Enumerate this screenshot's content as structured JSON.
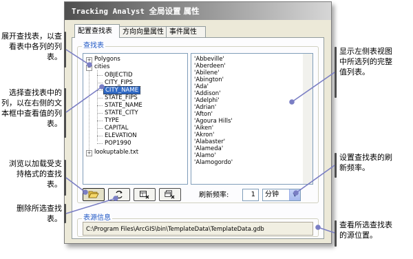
{
  "dialog": {
    "title_latin": "Tracking Analyst",
    "title_cjk": "全局设置 属性",
    "tabs": [
      {
        "label": "配置查找表"
      },
      {
        "label": "方向向量属性"
      },
      {
        "label": "事件属性"
      }
    ],
    "lookup_group_label": "查找表",
    "tree": {
      "polygons": "Polygons",
      "cities": "cities",
      "fields": [
        "OBJECTID",
        "CITY_FIPS",
        "CITY_NAME",
        "STATE_FIPS",
        "STATE_NAME",
        "STATE_CITY",
        "TYPE",
        "CAPITAL",
        "ELEVATION",
        "POP1990"
      ],
      "selected_field": "CITY_NAME",
      "lookuptable": "lookuptable.txt"
    },
    "values": [
      "'Abbeville'",
      "'Aberdeen'",
      "'Abilene'",
      "'Abington'",
      "'Ada'",
      "'Addison'",
      "'Adelphi'",
      "'Adrian'",
      "'Afton'",
      "'Agoura Hills'",
      "'Aiken'",
      "'Akron'",
      "'Alabaster'",
      "'Alameda'",
      "'Alamo'",
      "'Alamogordo'"
    ],
    "refresh": {
      "label": "刷新频率:",
      "value": "1",
      "unit": "分钟"
    },
    "source_group_label": "表源信息",
    "source_path": "C:\\Program Files\\ArcGIS\\bin\\TemplateData\\TemplateData.gdb"
  },
  "callouts": {
    "expand_table": "展开查找表，以查看表中各列的列表。",
    "select_column": "选择查找表中的列，以在右侧的文本框中查看值的列表。",
    "browse_load": "浏览以加载受支持格式的查找表。",
    "remove_table": "删除所选查找表。",
    "show_values": "显示左侧表视图中所选列的完整值列表。",
    "set_refresh": "设置查找表的刷新频率。",
    "view_source": "查看所选查找表的源位置。"
  }
}
